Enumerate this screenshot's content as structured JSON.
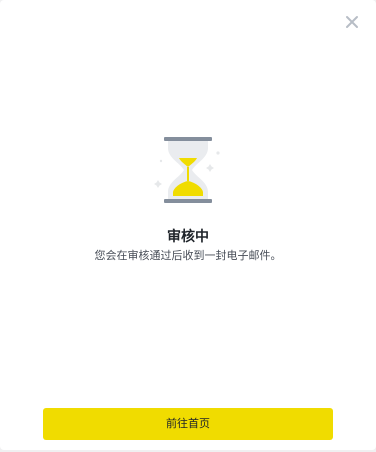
{
  "modal": {
    "close_icon": "close-icon",
    "illustration_icon": "hourglass-icon",
    "title": "审核中",
    "description": "您会在审核通过后收到一封电子邮件。",
    "primary_button_label": "前往首页"
  },
  "colors": {
    "accent": "#f0dc00",
    "title_text": "#1e2329",
    "body_text": "#474d57",
    "close_icon": "#b7bdc6"
  }
}
